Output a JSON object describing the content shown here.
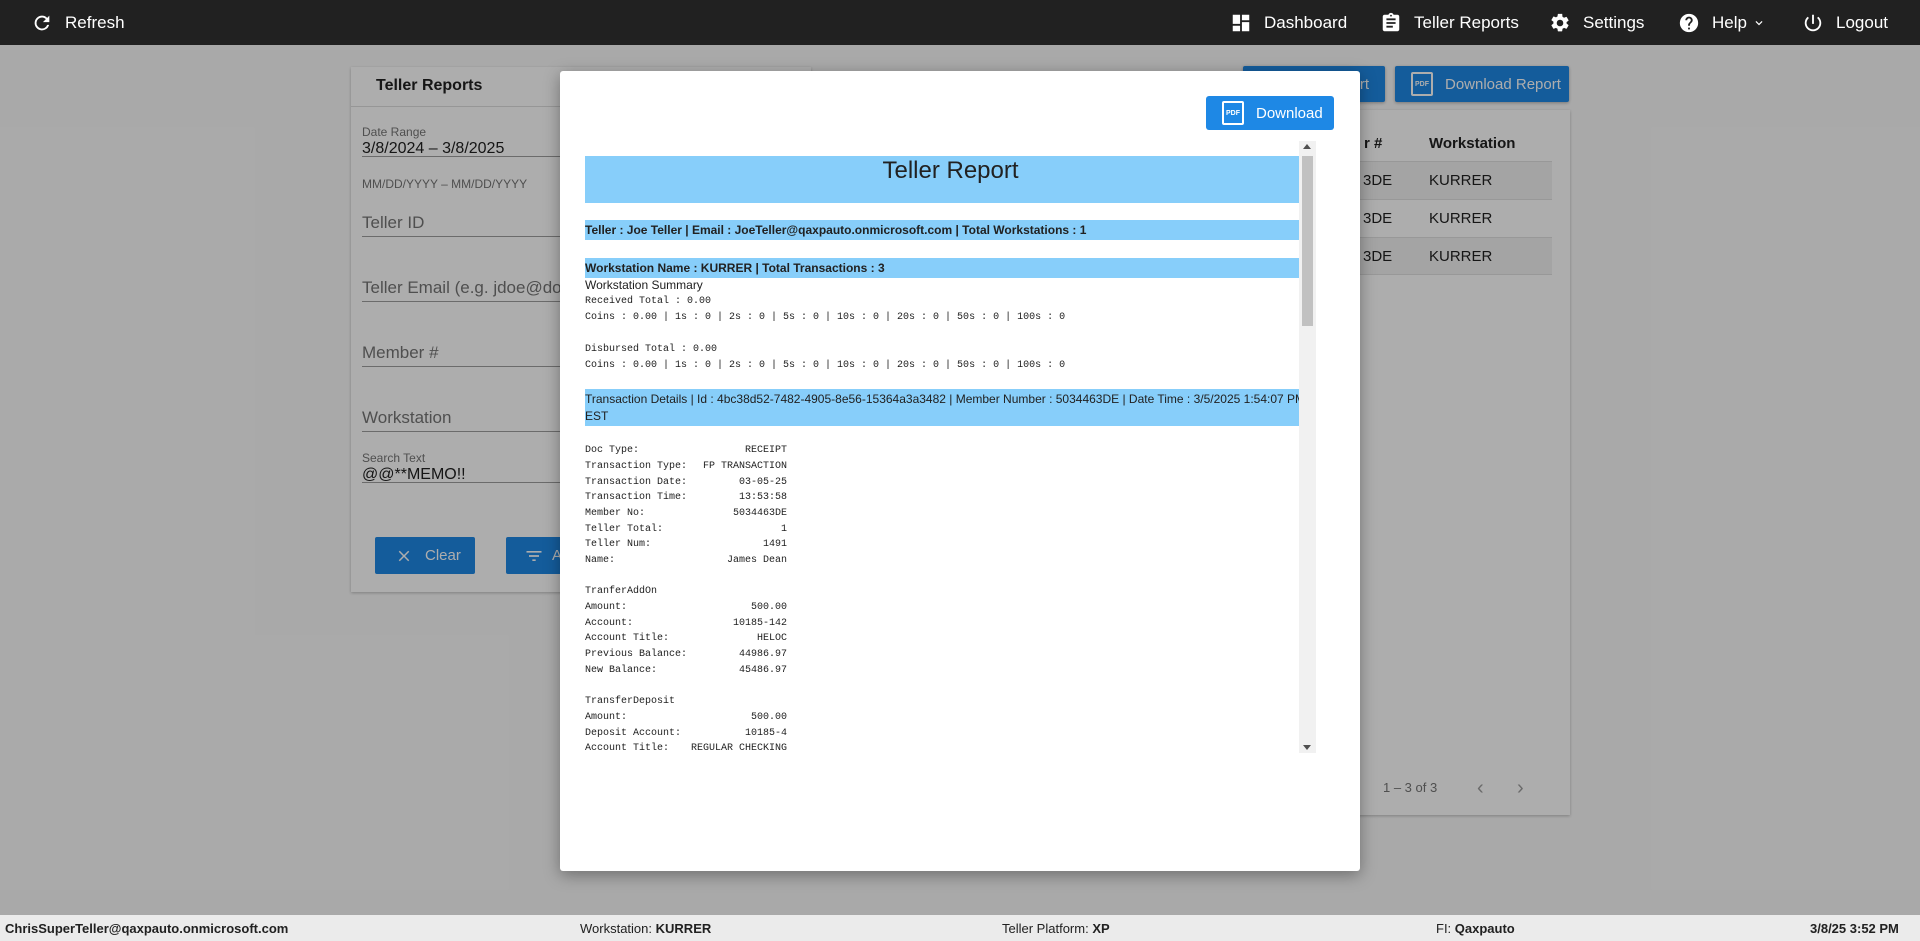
{
  "topbar": {
    "refresh": "Refresh",
    "dashboard": "Dashboard",
    "teller_reports": "Teller Reports",
    "settings": "Settings",
    "help": "Help",
    "logout": "Logout"
  },
  "left_panel": {
    "title": "Teller Reports",
    "date_range_label": "Date Range",
    "date_range_value": "3/8/2024 – 3/8/2025",
    "date_hint": "MM/DD/YYYY – MM/DD/YYYY",
    "teller_id_placeholder": "Teller ID",
    "teller_email_placeholder": "Teller Email (e.g. jdoe@dom",
    "member_placeholder": "Member #",
    "workstation_placeholder": "Workstation",
    "search_label": "Search Text",
    "search_value": "@@**MEMO!!",
    "clear_button": "Clear",
    "apply_button": "A"
  },
  "right_buttons": {
    "report_button": "rt",
    "download_report_button": "Download Report",
    "pdf_icon_text": "PDF"
  },
  "results_table": {
    "headers": [
      "r #",
      "Workstation"
    ],
    "rows": [
      {
        "member": "3DE",
        "workstation": "KURRER"
      },
      {
        "member": "3DE",
        "workstation": "KURRER"
      },
      {
        "member": "3DE",
        "workstation": "KURRER"
      }
    ],
    "pager": "1 – 3 of 3"
  },
  "modal": {
    "download_button": "Download",
    "report": {
      "title": "Teller Report",
      "teller_line": "Teller : Joe Teller | Email : JoeTeller@qaxpauto.onmicrosoft.com | Total Workstations : 1",
      "workstation_line": "Workstation Name : KURRER | Total Transactions : 3",
      "summary_title": "Workstation Summary",
      "received_total": "Received Total : 0.00",
      "received_coins": "Coins : 0.00 | 1s : 0 | 2s : 0 | 5s : 0 | 10s : 0 | 20s : 0 | 50s : 0 | 100s : 0",
      "disbursed_total": "Disbursed Total : 0.00",
      "disbursed_coins": "Coins : 0.00 | 1s : 0 | 2s : 0 | 5s : 0 | 10s : 0 | 20s : 0 | 50s : 0 | 100s : 0",
      "transaction_line_1": "Transaction Details | Id : 4bc38d52-7482-4905-8e56-15364a3a3482 | Member Number : 5034463DE | Date Time : 3/5/2025 1:54:07 PM",
      "transaction_line_2": "EST",
      "receipt": [
        {
          "k": "Doc Type:",
          "v": "RECEIPT"
        },
        {
          "k": "Transaction Type:",
          "v": "FP TRANSACTION"
        },
        {
          "k": "Transaction Date:",
          "v": "03-05-25"
        },
        {
          "k": "Transaction Time:",
          "v": "13:53:58"
        },
        {
          "k": "Member No:",
          "v": "5034463DE"
        },
        {
          "k": "Teller Total:",
          "v": "1"
        },
        {
          "k": "Teller Num:",
          "v": "1491"
        },
        {
          "k": "Name:",
          "v": "James Dean"
        }
      ],
      "addon_title": "TranferAddOn",
      "addon": [
        {
          "k": "Amount:",
          "v": "500.00"
        },
        {
          "k": "Account:",
          "v": "10185-142"
        },
        {
          "k": "Account Title:",
          "v": "HELOC"
        },
        {
          "k": "Previous Balance:",
          "v": "44986.97"
        },
        {
          "k": "New Balance:",
          "v": "45486.97"
        }
      ],
      "deposit_title": "TransferDeposit",
      "deposit": [
        {
          "k": "Amount:",
          "v": "500.00"
        },
        {
          "k": "Deposit Account:",
          "v": "10185-4"
        },
        {
          "k": "Account Title:",
          "v": "REGULAR CHECKING"
        }
      ]
    }
  },
  "statusbar": {
    "user": "ChrisSuperTeller@qaxpauto.onmicrosoft.com",
    "workstation_label": "Workstation:",
    "workstation_value": "KURRER",
    "platform_label": "Teller Platform:",
    "platform_value": "XP",
    "fi_label": "FI:",
    "fi_value": "Qaxpauto",
    "datetime": "3/8/25 3:52 PM"
  }
}
